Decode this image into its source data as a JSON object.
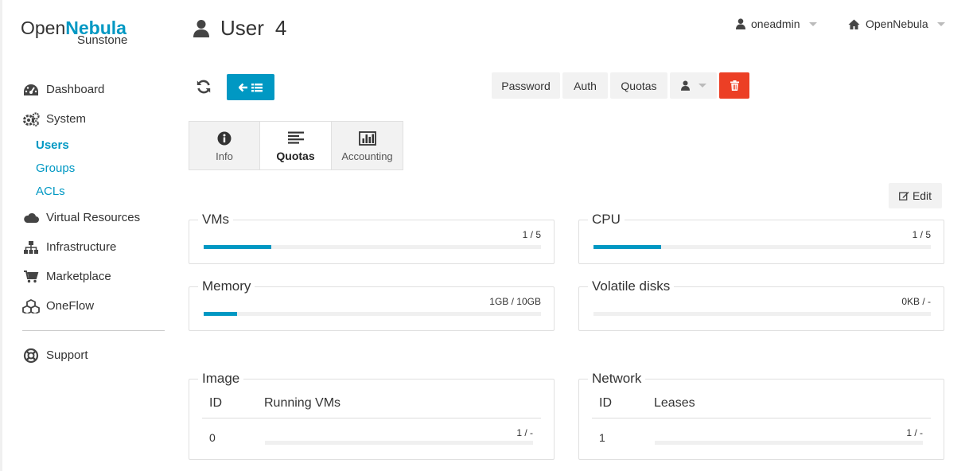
{
  "logo": {
    "open": "Open",
    "nebula": "Nebula",
    "sunstone": "Sunstone"
  },
  "sidebar": {
    "items": [
      {
        "label": "Dashboard",
        "icon": "dashboard-icon"
      },
      {
        "label": "System",
        "icon": "gears-icon"
      },
      {
        "label": "Users",
        "sub": true,
        "active": true
      },
      {
        "label": "Groups",
        "sub": true
      },
      {
        "label": "ACLs",
        "sub": true
      },
      {
        "label": "Virtual Resources",
        "icon": "cloud-icon"
      },
      {
        "label": "Infrastructure",
        "icon": "sitemap-icon"
      },
      {
        "label": "Marketplace",
        "icon": "cart-icon"
      },
      {
        "label": "OneFlow",
        "icon": "cubes-icon"
      },
      {
        "label": "Support",
        "icon": "lifebuoy-icon"
      }
    ]
  },
  "header": {
    "title": "User",
    "id": "4",
    "user_menu": "oneadmin",
    "zone_menu": "OpenNebula"
  },
  "toolbar": {
    "password": "Password",
    "auth": "Auth",
    "quotas": "Quotas"
  },
  "tabs": [
    {
      "label": "Info",
      "icon": "info-icon"
    },
    {
      "label": "Quotas",
      "icon": "align-left-icon",
      "active": true
    },
    {
      "label": "Accounting",
      "icon": "bar-chart-icon"
    }
  ],
  "edit_label": "Edit",
  "quotas": {
    "vms": {
      "label": "VMs",
      "value": "1 / 5",
      "fraction": 0.2
    },
    "cpu": {
      "label": "CPU",
      "value": "1 / 5",
      "fraction": 0.2
    },
    "memory": {
      "label": "Memory",
      "value": "1GB / 10GB",
      "fraction": 0.1
    },
    "volatile": {
      "label": "Volatile disks",
      "value": "0KB / -",
      "fraction": 0
    }
  },
  "image": {
    "label": "Image",
    "col_id": "ID",
    "col_value": "Running VMs",
    "row_id": "0",
    "row_value": "1 / -"
  },
  "network": {
    "label": "Network",
    "col_id": "ID",
    "col_value": "Leases",
    "row_id": "1",
    "row_value": "1 / -"
  },
  "colors": {
    "accent": "#0098c3",
    "danger": "#ec3f25"
  }
}
